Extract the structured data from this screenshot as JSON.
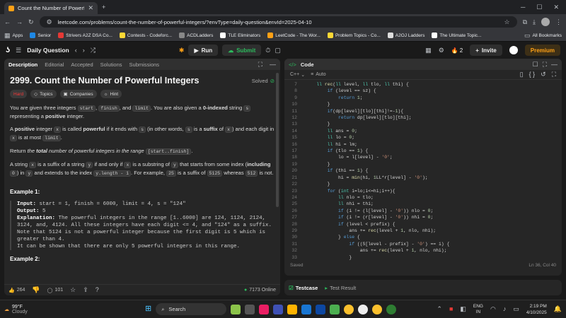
{
  "browser": {
    "tab_title": "Count the Number of Powerful",
    "url": "leetcode.com/problems/count-the-number-of-powerful-integers/?envType=daily-question&envId=2025-04-10",
    "bookmarks": [
      "Apps",
      "Senior",
      "Strivers A2Z DSA Co...",
      "Contests - Codeforc...",
      "ACDLadders",
      "TLE Eliminators",
      "LeetCode - The Wor...",
      "Problem Topics - Co...",
      "A2OJ Ladders",
      "The Ultimate Topic..."
    ],
    "all_bookmarks": "All Bookmarks"
  },
  "header": {
    "daily_question": "Daily Question",
    "run": "Run",
    "submit": "Submit",
    "streak": "2",
    "invite": "Invite",
    "premium": "Premium"
  },
  "left": {
    "tabs": [
      "Description",
      "Editorial",
      "Accepted",
      "Solutions",
      "Submissions"
    ],
    "title": "2999. Count the Number of Powerful Integers",
    "solved": "Solved",
    "chips": [
      "Hard",
      "Topics",
      "Companies",
      "Hint"
    ],
    "example_heading": "Example 1:",
    "example": {
      "input_label": "Input:",
      "input": "start = 1, finish = 6000, limit = 4, s = \"124\"",
      "output_label": "Output:",
      "output": "5",
      "expl_label": "Explanation:",
      "expl1": "The powerful integers in the range [1..6000] are 124, 1124, 2124,",
      "expl2": "3124, and, 4124. All these integers have each digit <= 4, and \"124\" as a suffix.",
      "expl3": "Note that 5124 is not a powerful integer because the first digit is 5 which is",
      "expl4": "greater than 4.",
      "expl5": "It can be shown that there are only 5 powerful integers in this range."
    },
    "example2_heading": "Example 2:",
    "likes": "264",
    "comments": "101",
    "online": "7173 Online"
  },
  "editor": {
    "title": "Code",
    "language": "C++",
    "mode": "Auto",
    "saved": "Saved",
    "position": "Ln 36, Col 40",
    "testcase": "Testcase",
    "test_result": "Test Result"
  },
  "taskbar": {
    "temp": "99°F",
    "weather": "Cloudy",
    "search": "Search",
    "lang1": "ENG",
    "lang2": "IN",
    "time": "2:19 PM",
    "date": "4/10/2025"
  }
}
